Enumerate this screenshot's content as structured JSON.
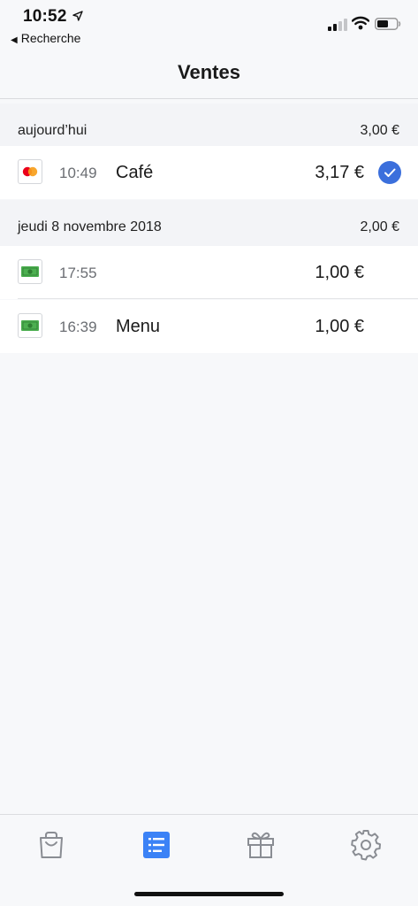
{
  "status_bar": {
    "time": "10:52",
    "back_label": "Recherche"
  },
  "header": {
    "title": "Ventes"
  },
  "sections": [
    {
      "date": "aujourd’hui",
      "total": "3,00 €",
      "rows": [
        {
          "payment_icon": "mastercard-icon",
          "time": "10:49",
          "label": "Café",
          "amount": "3,17 €",
          "checked": true
        }
      ]
    },
    {
      "date": "jeudi 8 novembre 2018",
      "total": "2,00 €",
      "rows": [
        {
          "payment_icon": "cash-icon",
          "time": "17:55",
          "label": "",
          "amount": "1,00 €",
          "checked": false
        },
        {
          "payment_icon": "cash-icon",
          "time": "16:39",
          "label": "Menu",
          "amount": "1,00 €",
          "checked": false
        }
      ]
    }
  ],
  "tab_bar": {
    "tabs": [
      {
        "icon": "shopping-bag-icon",
        "active": false
      },
      {
        "icon": "list-icon",
        "active": true
      },
      {
        "icon": "gift-icon",
        "active": false
      },
      {
        "icon": "gear-icon",
        "active": false
      }
    ],
    "active_color": "#3b82f6",
    "inactive_color": "#8a8d93"
  },
  "colors": {
    "accent": "#3b6fdc",
    "cash_green": "#4caf50",
    "mastercard_red": "#eb001b",
    "mastercard_orange": "#f79e1b"
  }
}
